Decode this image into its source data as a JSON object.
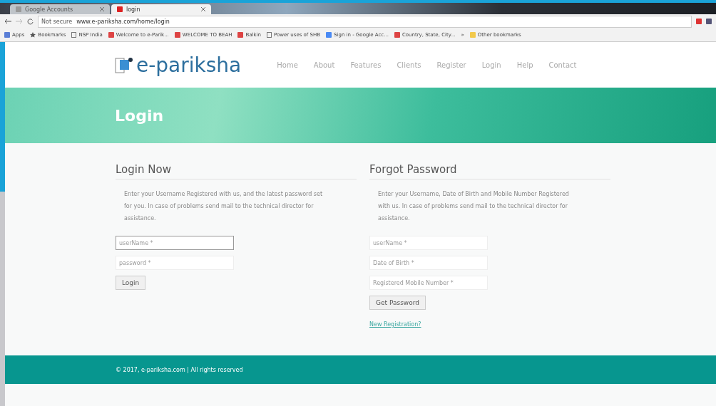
{
  "browser": {
    "tabs": [
      {
        "label": "Google Accounts",
        "selected": false
      },
      {
        "label": "login",
        "selected": true
      }
    ],
    "security": "Not secure",
    "url": "www.e-pariksha.com/home/login",
    "bookmarks": [
      {
        "label": "Apps",
        "kind": "apps"
      },
      {
        "label": "Bookmarks",
        "kind": "star"
      },
      {
        "label": "NSP India",
        "kind": "page"
      },
      {
        "label": "Welcome to e-Parik...",
        "kind": "site"
      },
      {
        "label": "WELCOME TO BEAH",
        "kind": "site"
      },
      {
        "label": "Balkin",
        "kind": "site"
      },
      {
        "label": "Power uses of SHB",
        "kind": "page"
      },
      {
        "label": "Sign in - Google Acc...",
        "kind": "google"
      },
      {
        "label": "Country, State, City...",
        "kind": "site"
      },
      {
        "label": "»",
        "kind": "more"
      },
      {
        "label": "Other bookmarks",
        "kind": "folder"
      }
    ]
  },
  "site": {
    "logo": "e-pariksha",
    "nav": [
      {
        "label": "Home"
      },
      {
        "label": "About"
      },
      {
        "label": "Features"
      },
      {
        "label": "Clients"
      },
      {
        "label": "Register"
      },
      {
        "label": "Login"
      },
      {
        "label": "Help"
      },
      {
        "label": "Contact"
      }
    ],
    "banner_title": "Login"
  },
  "login": {
    "title": "Login Now",
    "text": "Enter your Username Registered with us, and the latest password set for you. In case of problems send mail to the technical director for assistance.",
    "fields": [
      {
        "placeholder": "userName *",
        "focused": true
      },
      {
        "placeholder": "password *",
        "focused": false
      }
    ],
    "button": "Login"
  },
  "forgot": {
    "title": "Forgot Password",
    "text": "Enter your Username, Date of Birth and Mobile Number Registered with us. In case of problems send mail to the technical director for assistance.",
    "fields": [
      {
        "placeholder": "userName *",
        "focused": false
      },
      {
        "placeholder": "Date of Birth *",
        "focused": false
      },
      {
        "placeholder": "Registered Mobile Number *",
        "focused": false
      }
    ],
    "button": "Get Password",
    "link": "New Registration?"
  },
  "footer": "© 2017, e-pariksha.com | All rights reserved"
}
